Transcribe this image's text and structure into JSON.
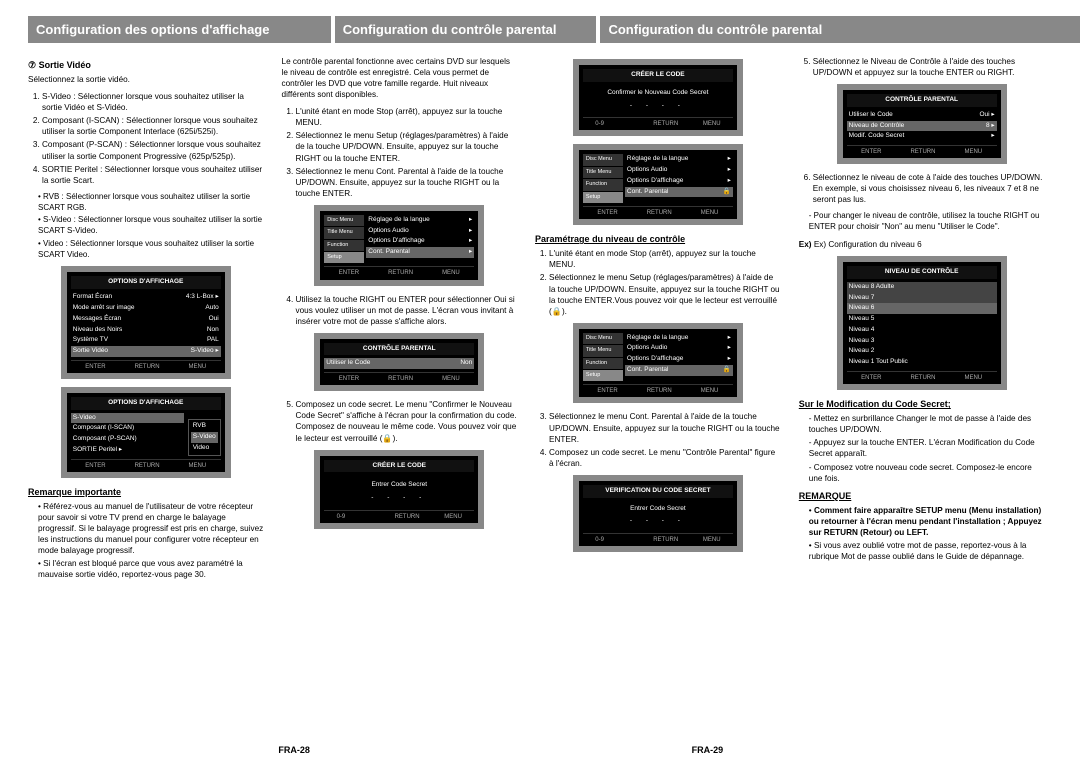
{
  "headers": {
    "left": "Configuration des options d'affichage",
    "mid": "Configuration du contrôle parental",
    "right": "Configuration du contrôle parental"
  },
  "page_left": "FRA-28",
  "page_right": "FRA-29",
  "col1": {
    "title": "Sortie Vidéo",
    "lead": "Sélectionnez la sortie vidéo.",
    "items": [
      "S-Video : Sélectionner lorsque vous souhaitez utiliser la sortie Vidéo et S-Vidéo.",
      "Composant (I-SCAN) : Sélectionner lorsque vous souhaitez utiliser la sortie Component Interlace (625i/525i).",
      "Composant (P-SCAN) : Sélectionner lorsque vous souhaitez utiliser la sortie Component Progressive (625p/525p).",
      "SORTIE Peritel : Sélectionner lorsque vous souhaitez utiliser la sortie Scart."
    ],
    "peritel_sub": [
      "RVB : Sélectionner lorsque vous souhaitez utiliser la sortie SCART RGB.",
      "S-Video : Sélectionner lorsque vous souhaitez utiliser la sortie SCART S-Video.",
      "Video : Sélectionner lorsque vous souhaitez utiliser la sortie SCART Video."
    ],
    "screen1": {
      "title": "OPTIONS D'AFFICHAGE",
      "rows": [
        [
          "Format Écran",
          "4:3 L-Box"
        ],
        [
          "Mode arrêt sur image",
          "Auto"
        ],
        [
          "Messages Écran",
          "Oui"
        ],
        [
          "Niveau des Noirs",
          "Non"
        ],
        [
          "Système TV",
          "PAL"
        ],
        [
          "Sortie Vidéo",
          "S-Video"
        ]
      ],
      "foot": [
        "ENTER",
        "RETURN",
        "MENU"
      ]
    },
    "screen2": {
      "title": "OPTIONS D'AFFICHAGE",
      "rows": [
        "S-Video",
        "Composant (I-SCAN)",
        "Composant (P-SCAN)",
        "SORTIE Peritel ▸"
      ],
      "popup": [
        "RVB",
        "S-Video",
        "Video"
      ],
      "foot": [
        "ENTER",
        "RETURN",
        "MENU"
      ]
    },
    "note_title": "Remarque importante",
    "notes": [
      "Référez-vous au manuel de l'utilisateur de votre récepteur pour savoir si votre TV prend en charge le balayage progressif. Si le balayage progressif est pris en charge, suivez les instructions du manuel pour configurer votre récepteur en mode balayage progressif.",
      "Si l'écran est bloqué parce que vous avez paramétré la mauvaise sortie vidéo, reportez-vous page 30."
    ]
  },
  "col2": {
    "intro": "Le contrôle parental fonctionne avec certains DVD sur lesquels le niveau de contrôle est enregistré. Cela vous permet de contrôler les DVD que votre famille regarde. Huit niveaux différents sont disponibles.",
    "steps12": [
      "L'unité étant en mode Stop (arrêt), appuyez sur la touche MENU.",
      "Sélectionnez le menu Setup (réglages/paramètres) à l'aide de la touche UP/DOWN. Ensuite, appuyez sur la touche RIGHT ou la touche ENTER.",
      "Sélectionnez le menu Cont. Parental à l'aide de la touche UP/DOWN. Ensuite, appuyez sur la touche RIGHT ou la touche ENTER."
    ],
    "screen1": {
      "rows": [
        "Réglage de la langue",
        "Options Audio",
        "Options D'affichage",
        "Cont. Parental"
      ],
      "foot": [
        "ENTER",
        "RETURN",
        "MENU"
      ]
    },
    "step4": "Utilisez la touche RIGHT ou ENTER pour sélectionner Oui si vous voulez utiliser un mot de passe. L'écran vous invitant à insérer votre mot de passe s'affiche alors.",
    "screen2": {
      "title": "CONTRÔLE PARENTAL",
      "row": [
        "Utiliser le Code",
        "Non"
      ],
      "foot": [
        "ENTER",
        "RETURN",
        "MENU"
      ]
    },
    "step5": "Composez un code secret. Le menu \"Confirmer le Nouveau Code Secret\" s'affiche à l'écran pour la confirmation du code. Composez de nouveau le même code. Vous pouvez voir que le lecteur est verrouillé (🔒).",
    "screen3": {
      "title": "CRÉER LE CODE",
      "label": "Entrer Code Secret",
      "code": "- - - -",
      "foot": [
        "0-9",
        "",
        "RETURN",
        "MENU"
      ]
    }
  },
  "col3": {
    "screen_top": {
      "title": "CRÉER LE CODE",
      "label": "Confirmer le Nouveau Code Secret",
      "code": "- - - -",
      "foot": [
        "0-9",
        "",
        "RETURN",
        "MENU"
      ]
    },
    "screen_setup": {
      "rows": [
        "Réglage de la langue",
        "Options Audio",
        "Options D'affichage",
        "Cont. Parental"
      ],
      "foot": [
        "ENTER",
        "RETURN",
        "MENU"
      ]
    },
    "sec_title": "Paramétrage du niveau de contrôle",
    "steps": [
      "L'unité étant en mode Stop (arrêt), appuyez sur la touche MENU.",
      "Sélectionnez le menu Setup (réglages/paramètres) à l'aide de la touche UP/DOWN. Ensuite, appuyez sur la touche RIGHT ou la touche ENTER.Vous pouvez voir que le lecteur est verrouillé (🔒).",
      "Sélectionnez le menu Cont. Parental à l'aide de la touche UP/DOWN. Ensuite, appuyez sur la touche RIGHT ou la touche ENTER.",
      "Composez un code secret. Le menu \"Contrôle Parental\" figure à l'écran."
    ],
    "screen_verify": {
      "title": "VERIFICATION DU CODE SECRET",
      "label": "Entrer Code Secret",
      "code": "- - - -",
      "foot": [
        "0-9",
        "",
        "RETURN",
        "MENU"
      ]
    }
  },
  "col4": {
    "step5": "Sélectionnez le Niveau de Contrôle à l'aide des touches UP/DOWN et appuyez sur la touche ENTER ou RIGHT.",
    "screen_cp": {
      "title": "CONTRÔLE PARENTAL",
      "rows": [
        [
          "Utiliser le Code",
          "Oui"
        ],
        [
          "Niveau de Contrôle",
          "8"
        ],
        [
          "Modif. Code Secret",
          ""
        ]
      ],
      "foot": [
        "ENTER",
        "RETURN",
        "MENU"
      ]
    },
    "step6": "Sélectionnez le niveau de cote à l'aide des touches UP/DOWN. En exemple, si vous choisissez niveau 6, les niveaux 7 et 8 ne seront pas lus.",
    "step6_sub": "- Pour changer le niveau de contrôle, utilisez la touche RIGHT ou ENTER pour choisir \"Non\" au menu \"Utiliser le Code\".",
    "ex_label": "Ex) Configuration du niveau 6",
    "screen_level": {
      "title": "NIVEAU DE CONTRÔLE",
      "rows": [
        "Niveau 8 Adulte",
        "Niveau 7",
        "Niveau 6",
        "Niveau 5",
        "Niveau 4",
        "Niveau 3",
        "Niveau 2",
        "Niveau 1 Tout Public"
      ],
      "foot": [
        "ENTER",
        "RETURN",
        "MENU"
      ]
    },
    "modif_title": "Sur le Modification du Code Secret;",
    "modif": [
      "Mettez en surbrillance Changer le mot de passe à l'aide des touches UP/DOWN.",
      "Appuyez sur la touche ENTER. L'écran Modification du Code Secret apparaît.",
      "Composez votre nouveau code secret. Composez-le encore une fois."
    ],
    "rem_title": "REMARQUE",
    "rem": [
      "Comment faire apparaître SETUP menu (Menu installation) ou retourner à l'écran menu pendant l'installation ; Appuyez sur RETURN (Retour) ou LEFT.",
      "Si vous avez oublié votre mot de passe, reportez-vous à la rubrique Mot de passe oublié dans le Guide de dépannage."
    ]
  }
}
